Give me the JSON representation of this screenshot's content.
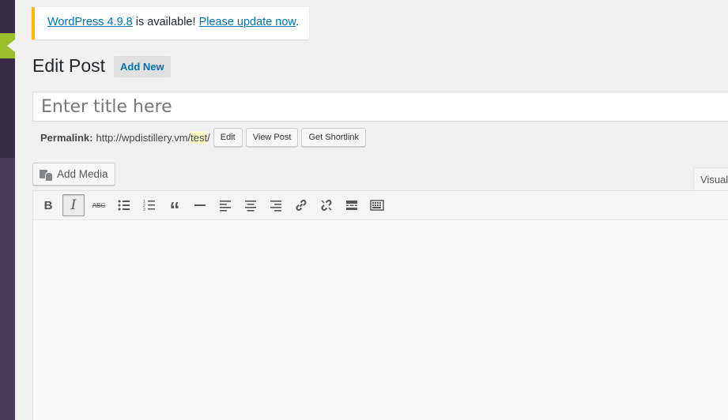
{
  "notice": {
    "link_version": "WordPress 4.9.8",
    "middle": " is available! ",
    "link_update": "Please update now",
    "end": "."
  },
  "page": {
    "title": "Edit Post",
    "add_new": "Add New"
  },
  "title_field": {
    "placeholder": "Enter title here",
    "value": ""
  },
  "permalink": {
    "label": "Permalink:",
    "base": "http://wpdistillery.vm/",
    "slug": "test",
    "trail": "/",
    "buttons": [
      "Edit",
      "View Post",
      "Get Shortlink"
    ]
  },
  "editor": {
    "add_media": "Add Media",
    "tab_visual": "Visual",
    "toolbar": [
      {
        "icon": "bold-icon",
        "label": "B"
      },
      {
        "icon": "italic-icon",
        "label": "I",
        "active": true
      },
      {
        "icon": "strikethrough-icon",
        "label": "ABC"
      },
      {
        "icon": "bullet-list-icon"
      },
      {
        "icon": "numbered-list-icon"
      },
      {
        "icon": "blockquote-icon"
      },
      {
        "icon": "horizontal-line-icon"
      },
      {
        "icon": "align-left-icon"
      },
      {
        "icon": "align-center-icon"
      },
      {
        "icon": "align-right-icon"
      },
      {
        "icon": "link-icon"
      },
      {
        "icon": "unlink-icon"
      },
      {
        "icon": "read-more-icon"
      },
      {
        "icon": "toolbar-toggle-icon"
      }
    ]
  },
  "colors": {
    "link": "#0073aa",
    "notice_border": "#ffb900",
    "sidebar": "#4a3b5a",
    "sidebar_accent": "#9bbf2a"
  }
}
